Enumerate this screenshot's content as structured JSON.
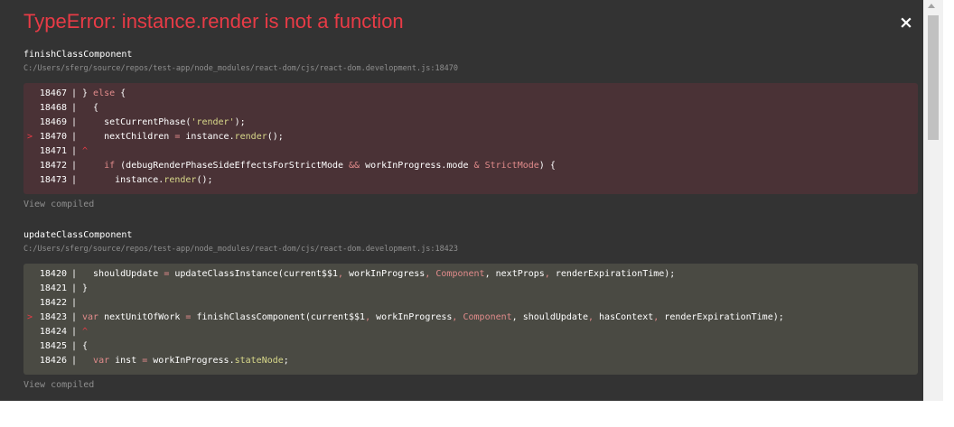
{
  "error": {
    "title": "TypeError: instance.render is not a function",
    "close_label": "×"
  },
  "frames": [
    {
      "function": "finishClassComponent",
      "path": "C:/Users/sferg/source/repos/test-app/node_modules/react-dom/cjs/react-dom.development.js:18470",
      "view_compiled": "View compiled",
      "highlighted_line": "18470",
      "lines": [
        "18467",
        "18468",
        "18469",
        "18470",
        "18471",
        "18472",
        "18473"
      ]
    },
    {
      "function": "updateClassComponent",
      "path": "C:/Users/sferg/source/repos/test-app/node_modules/react-dom/cjs/react-dom.development.js:18423",
      "view_compiled": "View compiled",
      "highlighted_line": "18423",
      "lines": [
        "18420",
        "18421",
        "18422",
        "18423",
        "18424",
        "18425",
        "18426"
      ]
    }
  ],
  "code_text": {
    "f0l0": [
      {
        "t": "} "
      },
      {
        "t": "else",
        "c": "kw"
      },
      {
        "t": " {"
      }
    ],
    "f0l1": [
      {
        "t": "  {"
      }
    ],
    "f0l2": [
      {
        "t": "    setCurrentPhase("
      },
      {
        "t": "'render'",
        "c": "str"
      },
      {
        "t": ");"
      }
    ],
    "f0l3": [
      {
        "t": "    nextChildren "
      },
      {
        "t": "=",
        "c": "op"
      },
      {
        "t": " instance."
      },
      {
        "t": "render",
        "c": "str"
      },
      {
        "t": "();"
      }
    ],
    "f0l4": [
      {
        "t": "^",
        "c": "car"
      }
    ],
    "f0l5": [
      {
        "t": "    "
      },
      {
        "t": "if",
        "c": "kw"
      },
      {
        "t": " (debugRenderPhaseSideEffectsForStrictMode "
      },
      {
        "t": "&&",
        "c": "op"
      },
      {
        "t": " workInProgress.mode "
      },
      {
        "t": "&",
        "c": "op"
      },
      {
        "t": " "
      },
      {
        "t": "StrictMode",
        "c": "kw"
      },
      {
        "t": ") {"
      }
    ],
    "f0l6": [
      {
        "t": "      instance."
      },
      {
        "t": "render",
        "c": "str"
      },
      {
        "t": "();"
      }
    ],
    "f1l0": [
      {
        "t": "  shouldUpdate "
      },
      {
        "t": "=",
        "c": "op"
      },
      {
        "t": " updateClassInstance(current$$1"
      },
      {
        "t": ",",
        "c": "op"
      },
      {
        "t": " workInProgress"
      },
      {
        "t": ",",
        "c": "op"
      },
      {
        "t": " "
      },
      {
        "t": "Component",
        "c": "kw"
      },
      {
        "t": ","
      },
      {
        "t": " nextProps"
      },
      {
        "t": ",",
        "c": "op"
      },
      {
        "t": " renderExpirationTime);"
      }
    ],
    "f1l1": [
      {
        "t": "}"
      }
    ],
    "f1l2": [
      {
        "t": ""
      }
    ],
    "f1l3": [
      {
        "t": "var",
        "c": "kw"
      },
      {
        "t": " nextUnitOfWork "
      },
      {
        "t": "=",
        "c": "op"
      },
      {
        "t": " finishClassComponent(current$$1"
      },
      {
        "t": ",",
        "c": "op"
      },
      {
        "t": " workInProgress"
      },
      {
        "t": ",",
        "c": "op"
      },
      {
        "t": " "
      },
      {
        "t": "Component",
        "c": "kw"
      },
      {
        "t": ","
      },
      {
        "t": " shouldUpdate"
      },
      {
        "t": ",",
        "c": "op"
      },
      {
        "t": " hasContext"
      },
      {
        "t": ",",
        "c": "op"
      },
      {
        "t": " renderExpirationTime);"
      }
    ],
    "f1l4": [
      {
        "t": "^",
        "c": "car"
      }
    ],
    "f1l5": [
      {
        "t": "{"
      }
    ],
    "f1l6": [
      {
        "t": "  "
      },
      {
        "t": "var",
        "c": "kw"
      },
      {
        "t": " inst "
      },
      {
        "t": "=",
        "c": "op"
      },
      {
        "t": " workInProgress."
      },
      {
        "t": "stateNode",
        "c": "str"
      },
      {
        "t": ";"
      }
    ]
  },
  "colors": {
    "error_red": "#e83b46",
    "background": "#333333",
    "active_frame_bg": "#4a3236",
    "frame_bg": "#4a4a43",
    "muted": "#8f8f8f"
  },
  "icons": {
    "close": "close-icon",
    "marker": "chevron-right-icon"
  },
  "marker_glyph": ">"
}
